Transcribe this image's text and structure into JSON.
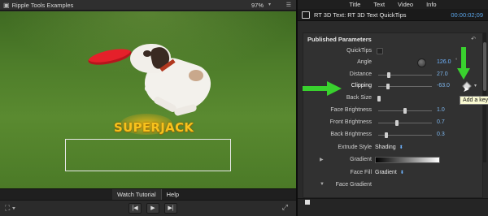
{
  "viewer": {
    "title": "Ripple Tools Examples",
    "zoom": "97%",
    "overlay_text": "SUPERJACK",
    "tabs": [
      "Watch Tutorial",
      "Help"
    ]
  },
  "inspector": {
    "tabs": [
      "Title",
      "Text",
      "Video",
      "Info"
    ],
    "clip_name": "RT 3D Text: RT 3D Text QuickTips",
    "timecode": "00:00:02;09",
    "panel_title": "Published Parameters",
    "params": [
      {
        "label": "QuickTips",
        "control": "checkbox"
      },
      {
        "label": "Angle",
        "control": "dial",
        "value": "126.0",
        "unit": "°"
      },
      {
        "label": "Distance",
        "control": "slider",
        "value": "27.0",
        "level": 0.2
      },
      {
        "label": "Clipping",
        "control": "slider",
        "value": "-63.0",
        "level": 0.18
      },
      {
        "label": "Back Size",
        "control": "slider",
        "value": "",
        "level": 0.02
      },
      {
        "label": "Face Brightness",
        "control": "slider",
        "value": "1.0",
        "level": 0.5
      },
      {
        "label": "Front Brightness",
        "control": "slider",
        "value": "0.7",
        "level": 0.35
      },
      {
        "label": "Back Brightness",
        "control": "slider",
        "value": "0.3",
        "level": 0.15
      },
      {
        "label": "Extrude Style",
        "control": "popup",
        "value": "Shading"
      },
      {
        "label": "Gradient",
        "control": "gradient"
      },
      {
        "label": "Face Fill",
        "control": "popup",
        "value": "Gradient"
      },
      {
        "label": "Face Gradient",
        "control": "disclosure"
      }
    ],
    "tooltip": "Add a keyframe"
  },
  "colors": {
    "accent_blue": "#6fb4ff",
    "annotation_green": "#39d12e",
    "overlay_gold": "#f7c21c"
  }
}
